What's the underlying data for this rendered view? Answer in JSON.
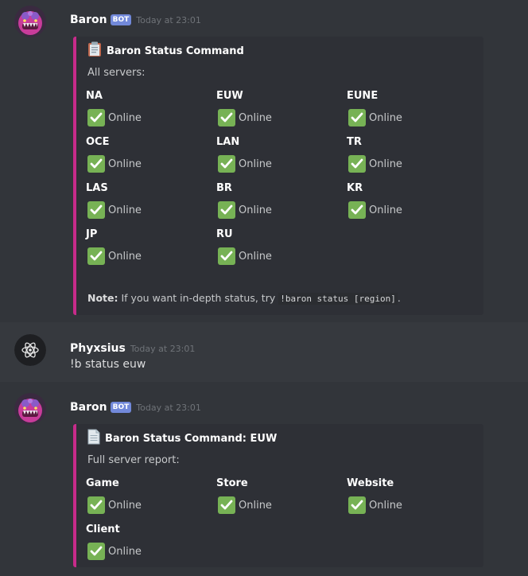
{
  "messages": [
    {
      "username": "Baron",
      "bot_tag": "BOT",
      "timestamp": "Today at 23:01",
      "embed": {
        "title": "Baron Status Command",
        "title_icon": "clipboard-icon",
        "description": "All servers:",
        "fields": [
          {
            "name": "NA",
            "status": "Online"
          },
          {
            "name": "EUW",
            "status": "Online"
          },
          {
            "name": "EUNE",
            "status": "Online"
          },
          {
            "name": "OCE",
            "status": "Online"
          },
          {
            "name": "LAN",
            "status": "Online"
          },
          {
            "name": "TR",
            "status": "Online"
          },
          {
            "name": "LAS",
            "status": "Online"
          },
          {
            "name": "BR",
            "status": "Online"
          },
          {
            "name": "KR",
            "status": "Online"
          },
          {
            "name": "JP",
            "status": "Online"
          },
          {
            "name": "RU",
            "status": "Online"
          }
        ],
        "note_label": "Note:",
        "note_text": " If you want in-depth status, try ",
        "note_code": "!baron status [region]",
        "note_end": "."
      }
    },
    {
      "username": "Phyxsius",
      "timestamp": "Today at 23:01",
      "text": "!b status euw"
    },
    {
      "username": "Baron",
      "bot_tag": "BOT",
      "timestamp": "Today at 23:01",
      "embed": {
        "title": "Baron Status Command: EUW",
        "title_icon": "document-icon",
        "description": "Full server report:",
        "fields": [
          {
            "name": "Game",
            "status": "Online"
          },
          {
            "name": "Store",
            "status": "Online"
          },
          {
            "name": "Website",
            "status": "Online"
          },
          {
            "name": "Client",
            "status": "Online"
          }
        ]
      }
    }
  ],
  "colors": {
    "background": "#36393e",
    "embed_bg": "#2e3036",
    "embed_accent": "#c72b8a",
    "bot_tag": "#7289da",
    "check": "#77b255"
  }
}
